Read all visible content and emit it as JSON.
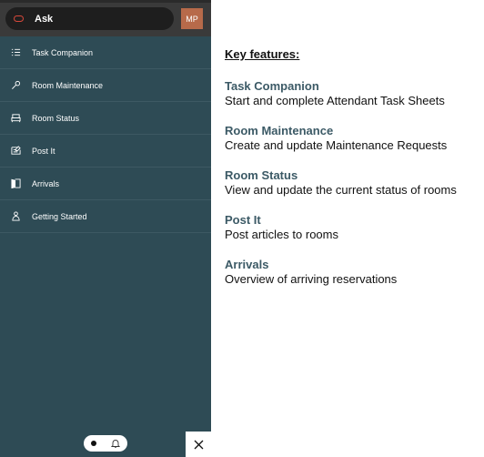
{
  "topbar": {
    "ask_label": "Ask",
    "avatar_initials": "MP"
  },
  "sidebar": {
    "items": [
      {
        "label": "Task Companion",
        "icon": "list-icon"
      },
      {
        "label": "Room Maintenance",
        "icon": "wrench-icon"
      },
      {
        "label": "Room Status",
        "icon": "bed-icon"
      },
      {
        "label": "Post It",
        "icon": "post-icon"
      },
      {
        "label": "Arrivals",
        "icon": "door-icon"
      },
      {
        "label": "Getting Started",
        "icon": "guide-icon"
      }
    ]
  },
  "main": {
    "heading": "Key features:",
    "features": [
      {
        "title": "Task Companion",
        "desc": "Start and complete Attendant Task Sheets"
      },
      {
        "title": "Room Maintenance",
        "desc": "Create and update Maintenance Requests"
      },
      {
        "title": "Room Status",
        "desc": "View and update the current status of rooms"
      },
      {
        "title": "Post It",
        "desc": "Post articles to rooms"
      },
      {
        "title": "Arrivals",
        "desc": "Overview of arriving reservations"
      }
    ]
  },
  "colors": {
    "nav_background": "#2e4b55",
    "topbar_background": "#3a3a3a",
    "avatar_background": "#b76a4a",
    "feature_title": "#3c5a66",
    "brand_accent": "#d6483a"
  }
}
